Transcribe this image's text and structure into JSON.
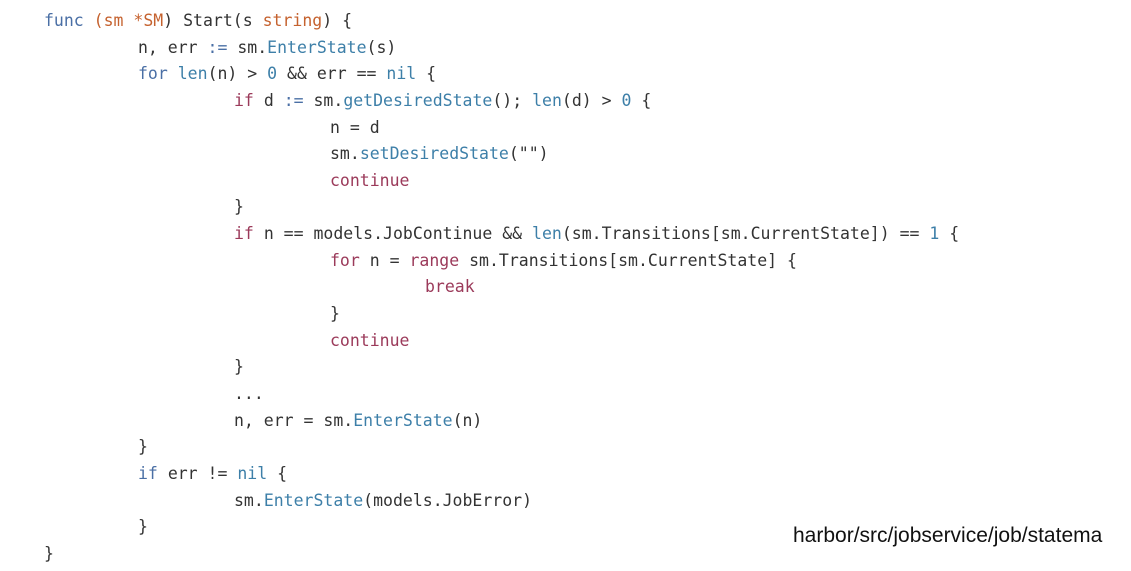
{
  "colors": {
    "keyword": "#4a6fa5",
    "identifier": "#333333",
    "type_orange": "#c5622f",
    "function_blue": "#3d7fa8",
    "control_flow": "#9b3a5a",
    "background": "#ffffff"
  },
  "code_lines": [
    [
      {
        "t": "func ",
        "c": "kw"
      },
      {
        "t": "(sm ",
        "c": "type"
      },
      {
        "t": "*SM",
        "c": "type"
      },
      {
        "t": ") ",
        "c": "ident"
      },
      {
        "t": "Start",
        "c": "ident"
      },
      {
        "t": "(s ",
        "c": "ident"
      },
      {
        "t": "string",
        "c": "type"
      },
      {
        "t": ") {",
        "c": "ident"
      }
    ],
    [
      {
        "t": "n, err ",
        "c": "ident"
      },
      {
        "t": ":= ",
        "c": "kw"
      },
      {
        "t": "sm.",
        "c": "ident"
      },
      {
        "t": "EnterState",
        "c": "func"
      },
      {
        "t": "(s)",
        "c": "ident"
      }
    ],
    [
      {
        "t": "for ",
        "c": "kw"
      },
      {
        "t": "len",
        "c": "func"
      },
      {
        "t": "(n) > ",
        "c": "ident"
      },
      {
        "t": "0",
        "c": "blue"
      },
      {
        "t": " && err == ",
        "c": "ident"
      },
      {
        "t": "nil",
        "c": "blue"
      },
      {
        "t": " {",
        "c": "ident"
      }
    ],
    [
      {
        "t": "if ",
        "c": "ctrl"
      },
      {
        "t": "d ",
        "c": "ident"
      },
      {
        "t": ":= ",
        "c": "kw"
      },
      {
        "t": "sm.",
        "c": "ident"
      },
      {
        "t": "getDesiredState",
        "c": "func"
      },
      {
        "t": "(); ",
        "c": "ident"
      },
      {
        "t": "len",
        "c": "func"
      },
      {
        "t": "(d) > ",
        "c": "ident"
      },
      {
        "t": "0",
        "c": "blue"
      },
      {
        "t": " {",
        "c": "ident"
      }
    ],
    [
      {
        "t": "n = d",
        "c": "ident"
      }
    ],
    [
      {
        "t": "sm.",
        "c": "ident"
      },
      {
        "t": "setDesiredState",
        "c": "func"
      },
      {
        "t": "(\"\")",
        "c": "ident"
      }
    ],
    [
      {
        "t": "continue",
        "c": "ctrl"
      }
    ],
    [
      {
        "t": "}",
        "c": "ident"
      }
    ],
    [
      {
        "t": "if ",
        "c": "ctrl"
      },
      {
        "t": "n == models.JobContinue && ",
        "c": "ident"
      },
      {
        "t": "len",
        "c": "func"
      },
      {
        "t": "(sm.Transitions[sm.CurrentState]) == ",
        "c": "ident"
      },
      {
        "t": "1",
        "c": "blue"
      },
      {
        "t": " {",
        "c": "ident"
      }
    ],
    [
      {
        "t": "for ",
        "c": "ctrl"
      },
      {
        "t": "n = ",
        "c": "ident"
      },
      {
        "t": "range ",
        "c": "ctrl"
      },
      {
        "t": "sm.Transitions[sm.CurrentState] {",
        "c": "ident"
      }
    ],
    [
      {
        "t": "break",
        "c": "ctrl"
      }
    ],
    [
      {
        "t": "}",
        "c": "ident"
      }
    ],
    [
      {
        "t": "continue",
        "c": "ctrl"
      }
    ],
    [
      {
        "t": "}",
        "c": "ident"
      }
    ],
    [
      {
        "t": "...",
        "c": "ident"
      }
    ],
    [
      {
        "t": "n, err = sm.",
        "c": "ident"
      },
      {
        "t": "EnterState",
        "c": "func"
      },
      {
        "t": "(n)",
        "c": "ident"
      }
    ],
    [
      {
        "t": "}",
        "c": "ident"
      }
    ],
    [
      {
        "t": "if ",
        "c": "kw"
      },
      {
        "t": "err != ",
        "c": "ident"
      },
      {
        "t": "nil",
        "c": "blue"
      },
      {
        "t": " {",
        "c": "ident"
      }
    ],
    [
      {
        "t": "sm.",
        "c": "ident"
      },
      {
        "t": "EnterState",
        "c": "func"
      },
      {
        "t": "(models.JobError)",
        "c": "ident"
      }
    ],
    [
      {
        "t": "}",
        "c": "ident"
      }
    ],
    [
      {
        "t": "}",
        "c": "ident"
      }
    ]
  ],
  "caption": {
    "path": "harbor/src/jobservice/job/statema"
  }
}
